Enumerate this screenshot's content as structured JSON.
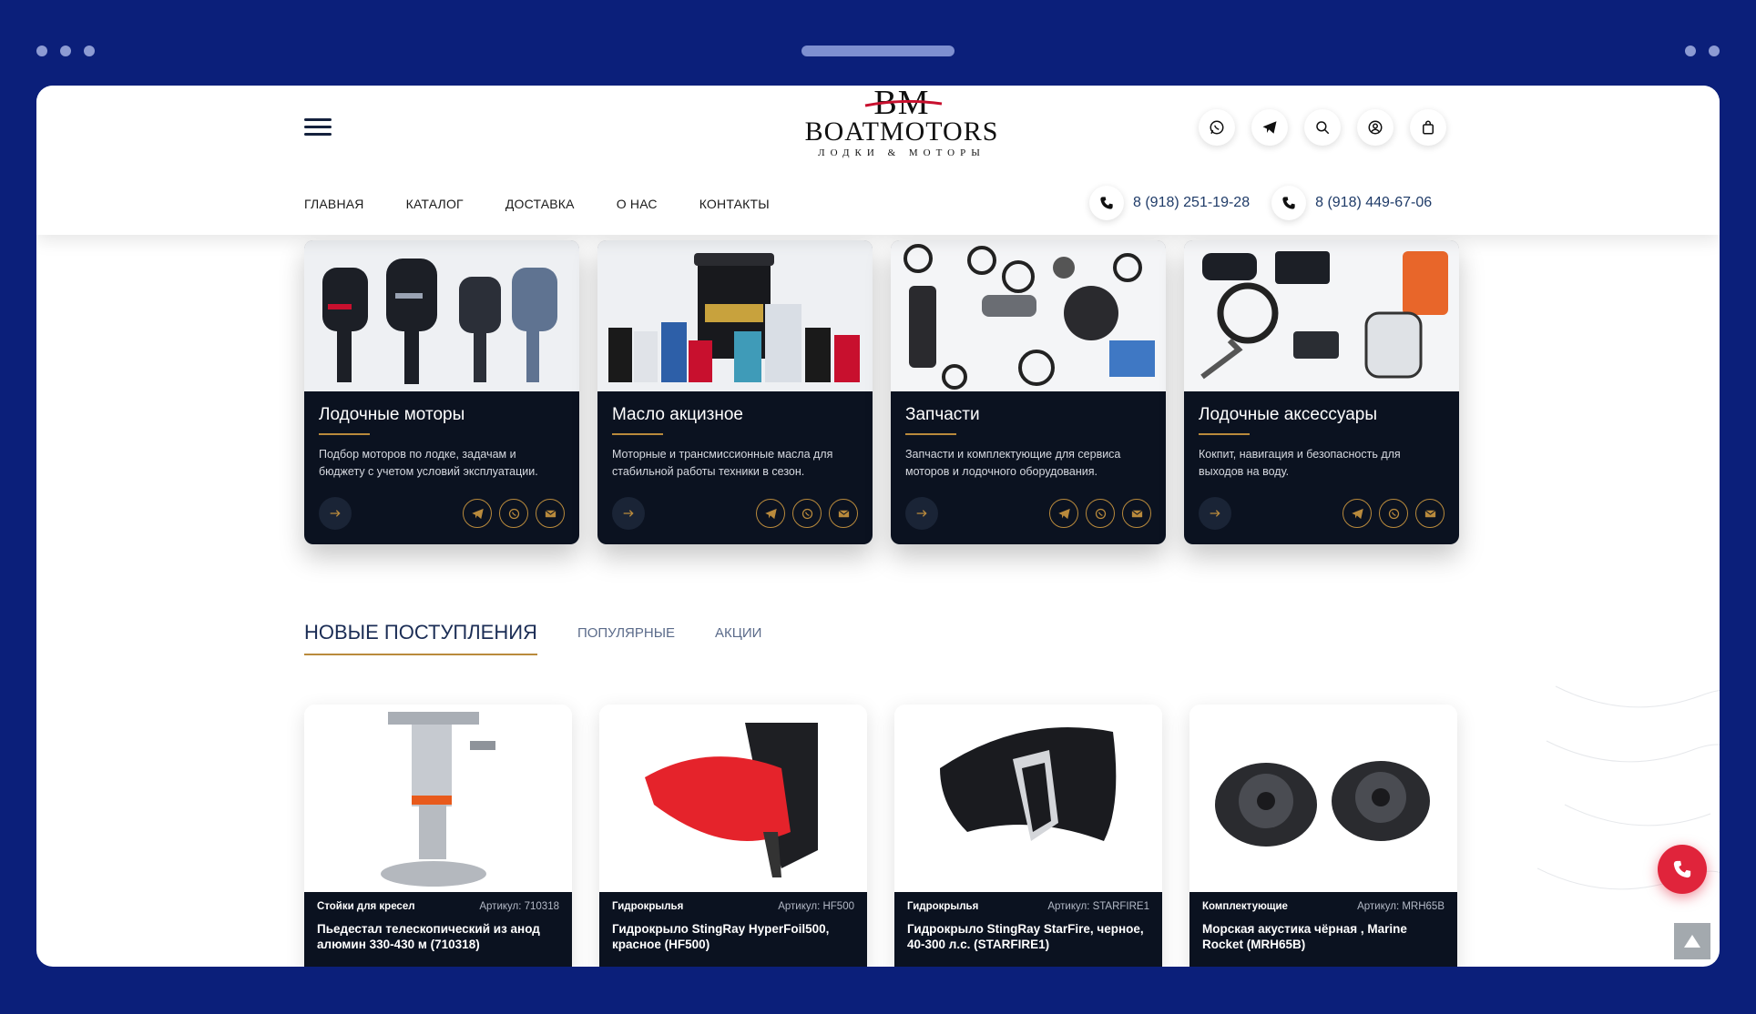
{
  "logo": {
    "mark": "BM",
    "name": "BOATMOTORS",
    "tagline": "ЛОДКИ & МОТОРЫ"
  },
  "header_icons": [
    "whatsapp-icon",
    "telegram-icon",
    "search-icon",
    "user-icon",
    "cart-icon"
  ],
  "nav": [
    "ГЛАВНАЯ",
    "КАТАЛОГ",
    "ДОСТАВКА",
    "О НАС",
    "КОНТАКТЫ"
  ],
  "phones": [
    "8 (918) 251-19-28",
    "8 (918) 449-67-06"
  ],
  "categories": [
    {
      "title": "Лодочные моторы",
      "desc": "Подбор моторов по лодке, задачам и бюджету с учетом условий эксплуатации."
    },
    {
      "title": "Масло акцизное",
      "desc": "Моторные и трансмиссионные масла для стабильной работы техники в сезон."
    },
    {
      "title": "Запчасти",
      "desc": "Запчасти и комплектующие для сервиса моторов и лодочного оборудования."
    },
    {
      "title": "Лодочные аксессуары",
      "desc": "Кокпит, навигация и безопасность для выходов на воду."
    }
  ],
  "tabs": {
    "active": "НОВЫЕ ПОСТУПЛЕНИЯ",
    "popular": "ПОПУЛЯРНЫЕ",
    "sales": "АКЦИИ"
  },
  "products": [
    {
      "category": "Стойки для кресел",
      "sku": "Артикул: 710318",
      "name": "Пьедестал телескопический из анод алюмин 330-430 м (710318)"
    },
    {
      "category": "Гидрокрылья",
      "sku": "Артикул: HF500",
      "name": "Гидрокрыло StingRay HyperFoil500, красное (HF500)"
    },
    {
      "category": "Гидрокрылья",
      "sku": "Артикул: STARFIRE1",
      "name": "Гидрокрыло StingRay StarFire, черное, 40-300 л.с. (STARFIRE1)"
    },
    {
      "category": "Комплектующие",
      "sku": "Артикул: MRH65B",
      "name": "Морская акустика чёрная , Marine Rocket (MRH65B)"
    }
  ],
  "colors": {
    "brand_blue": "#0b1f7a",
    "dark": "#0b1220",
    "gold": "#b98a3c",
    "call_red": "#e0243b"
  }
}
